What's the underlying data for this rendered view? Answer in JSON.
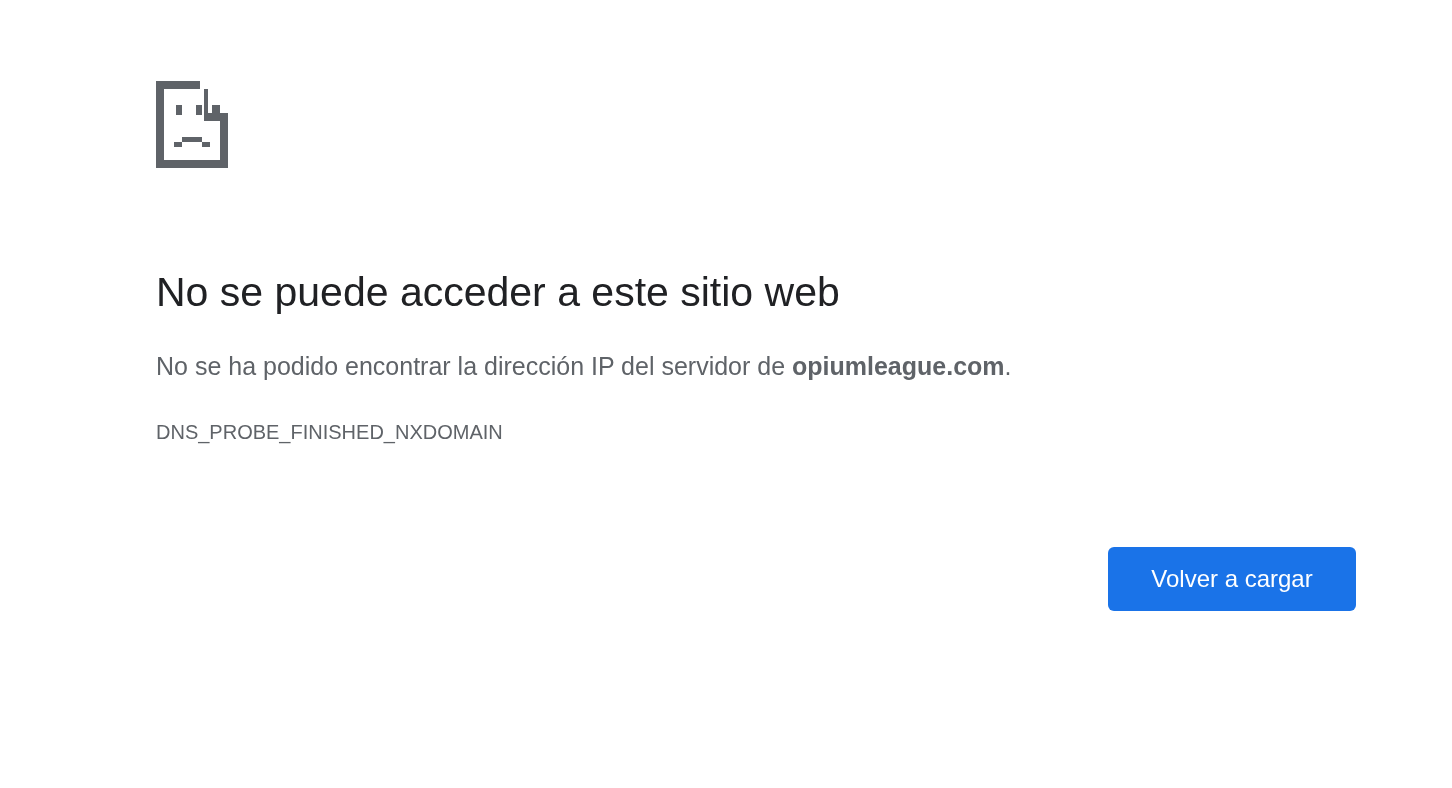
{
  "heading": "No se puede acceder a este sitio web",
  "message": "No se ha podido encontrar la dirección IP del servidor de **opiumleague.com**.",
  "error_code": "DNS_PROBE_FINISHED_NXDOMAIN",
  "button": "Volver a cargar"
}
